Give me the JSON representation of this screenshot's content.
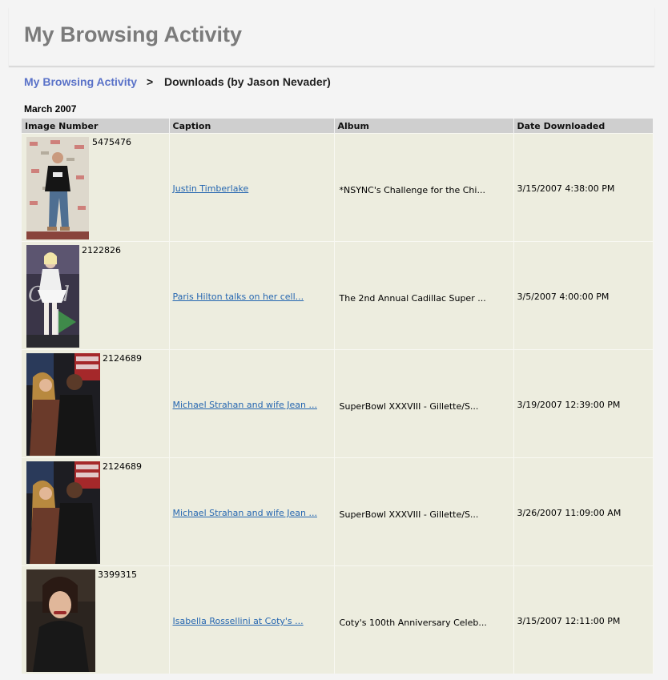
{
  "header": {
    "title": "My Browsing Activity"
  },
  "breadcrumb": {
    "link": "My Browsing Activity",
    "separator": ">",
    "current": "Downloads (by Jason Nevader)"
  },
  "month": "March 2007",
  "table": {
    "columns": [
      "Image Number",
      "Caption",
      "Album",
      "Date  Downloaded"
    ],
    "rows": [
      {
        "image_number": "5475476",
        "caption": "Justin Timberlake",
        "album": "*NSYNC's Challenge for the Chi...",
        "date": "3/15/2007 4:38:00 PM"
      },
      {
        "image_number": "2122826",
        "caption": "Paris Hilton talks on her cell...",
        "album": "The 2nd Annual Cadillac Super ...",
        "date": "3/5/2007 4:00:00 PM"
      },
      {
        "image_number": "2124689",
        "caption": "Michael Strahan and wife Jean ...",
        "album": "SuperBowl XXXVIII - Gillette/S...",
        "date": "3/19/2007 12:39:00 PM"
      },
      {
        "image_number": "2124689",
        "caption": "Michael Strahan and wife Jean ...",
        "album": "SuperBowl XXXVIII - Gillette/S...",
        "date": "3/26/2007 11:09:00 AM"
      },
      {
        "image_number": "3399315",
        "caption": "Isabella Rossellini at Coty's ...",
        "album": "Coty's 100th Anniversary Celeb...",
        "date": "3/15/2007 12:11:00 PM"
      }
    ]
  },
  "colors": {
    "title": "#7b7b7b",
    "link": "#5a72c8",
    "caption_link": "#2566b0",
    "row_bg": "#ededdf",
    "header_bg": "#cfcfcf"
  }
}
